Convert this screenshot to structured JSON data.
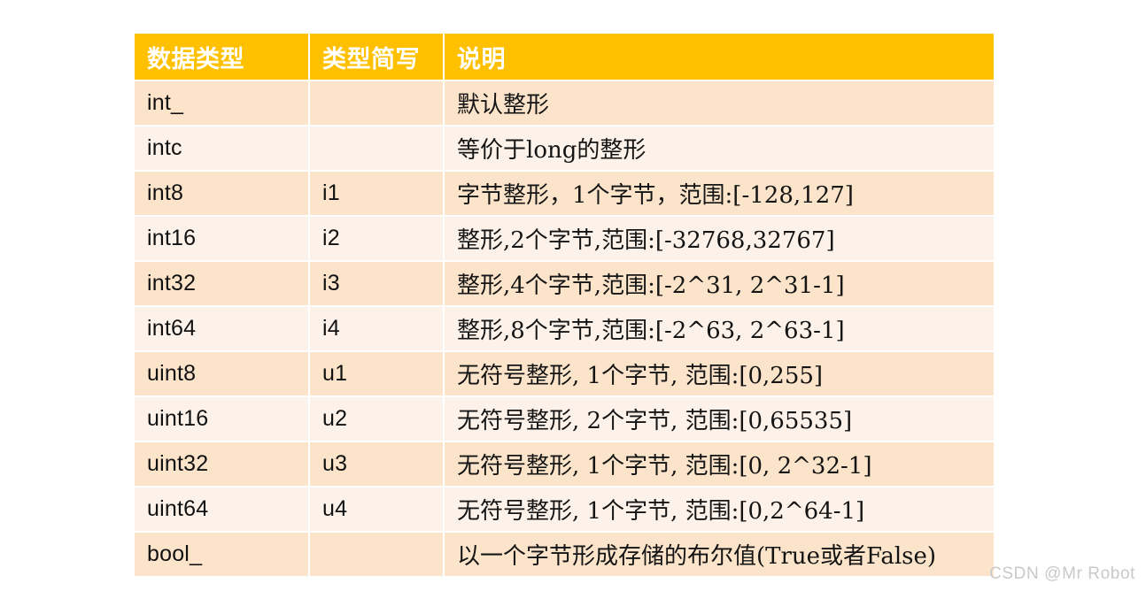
{
  "table": {
    "columns": [
      {
        "key": "type",
        "label": "数据类型"
      },
      {
        "key": "abbr",
        "label": "类型简写"
      },
      {
        "key": "desc",
        "label": "说明"
      }
    ],
    "rows": [
      {
        "type": "int_",
        "abbr": "",
        "desc": "默认整形"
      },
      {
        "type": "intc",
        "abbr": "",
        "desc": "等价于long的整形"
      },
      {
        "type": "int8",
        "abbr": "i1",
        "desc": "字节整形，1个字节，范围:[-128,127]"
      },
      {
        "type": "int16",
        "abbr": "i2",
        "desc": "整形,2个字节,范围:[-32768,32767]"
      },
      {
        "type": "int32",
        "abbr": "i3",
        "desc": "整形,4个字节,范围:[-2^31, 2^31-1]"
      },
      {
        "type": "int64",
        "abbr": "i4",
        "desc": "整形,8个字节,范围:[-2^63, 2^63-1]"
      },
      {
        "type": "uint8",
        "abbr": "u1",
        "desc": "无符号整形, 1个字节, 范围:[0,255]"
      },
      {
        "type": "uint16",
        "abbr": "u2",
        "desc": "无符号整形, 2个字节, 范围:[0,65535]"
      },
      {
        "type": "uint32",
        "abbr": "u3",
        "desc": "无符号整形, 1个字节, 范围:[0, 2^32-1]"
      },
      {
        "type": "uint64",
        "abbr": "u4",
        "desc": "无符号整形, 1个字节, 范围:[0,2^64-1]"
      },
      {
        "type": "bool_",
        "abbr": "",
        "desc": "以一个字节形成存储的布尔值(True或者False)"
      }
    ]
  },
  "watermark": {
    "text": "CSDN @Mr  Robot"
  },
  "colors": {
    "header_background": "#FFC000",
    "header_text": "#FFFFFF",
    "row_odd_background": "#FCE4CB",
    "row_even_background": "#FDF2EA",
    "body_text": "#141414",
    "page_background": "#FFFFFF",
    "watermark_text": "#C9C9C9"
  }
}
